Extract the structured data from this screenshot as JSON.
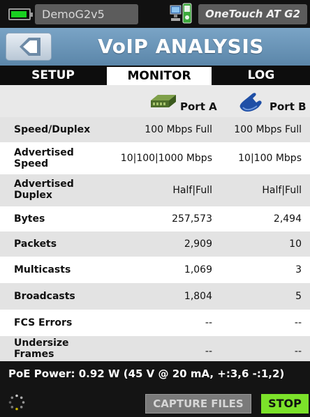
{
  "status_bar": {
    "device_name": "DemoG2v5",
    "model": "OneTouch AT G2"
  },
  "title_bar": {
    "title": "VoIP ANALYSIS"
  },
  "tabs": [
    {
      "label": "SETUP",
      "selected": false
    },
    {
      "label": "MONITOR",
      "selected": true
    },
    {
      "label": "LOG",
      "selected": false
    }
  ],
  "table": {
    "port_a": "Port A",
    "port_b": "Port B",
    "rows": [
      {
        "label": "Speed/Duplex",
        "port_a": "100 Mbps Full",
        "port_b": "100 Mbps Full"
      },
      {
        "label": "Advertised Speed",
        "port_a": "10|100|1000 Mbps",
        "port_b": "10|100 Mbps"
      },
      {
        "label": "Advertised Duplex",
        "port_a": "Half|Full",
        "port_b": "Half|Full"
      },
      {
        "label": "Bytes",
        "port_a": "257,573",
        "port_b": "2,494"
      },
      {
        "label": "Packets",
        "port_a": "2,909",
        "port_b": "10"
      },
      {
        "label": "Multicasts",
        "port_a": "1,069",
        "port_b": "3"
      },
      {
        "label": "Broadcasts",
        "port_a": "1,804",
        "port_b": "5"
      },
      {
        "label": "FCS Errors",
        "port_a": "--",
        "port_b": "--"
      },
      {
        "label": "Undersize Frames",
        "port_a": "--",
        "port_b": "--"
      }
    ]
  },
  "footer": {
    "poe_text": "PoE Power: 0.92 W (45 V @ 20 mA, +:3,6 -:1,2)",
    "capture_label": "CAPTURE FILES",
    "stop_label": "STOP"
  },
  "colors": {
    "title_bar": "#6b95b8",
    "stop_button": "#7ce22a",
    "battery": "#18d020"
  },
  "icons": [
    "battery-icon",
    "back-arrow-icon",
    "network-status-icon",
    "switch-port-icon",
    "phone-icon",
    "busy-spinner-icon"
  ]
}
